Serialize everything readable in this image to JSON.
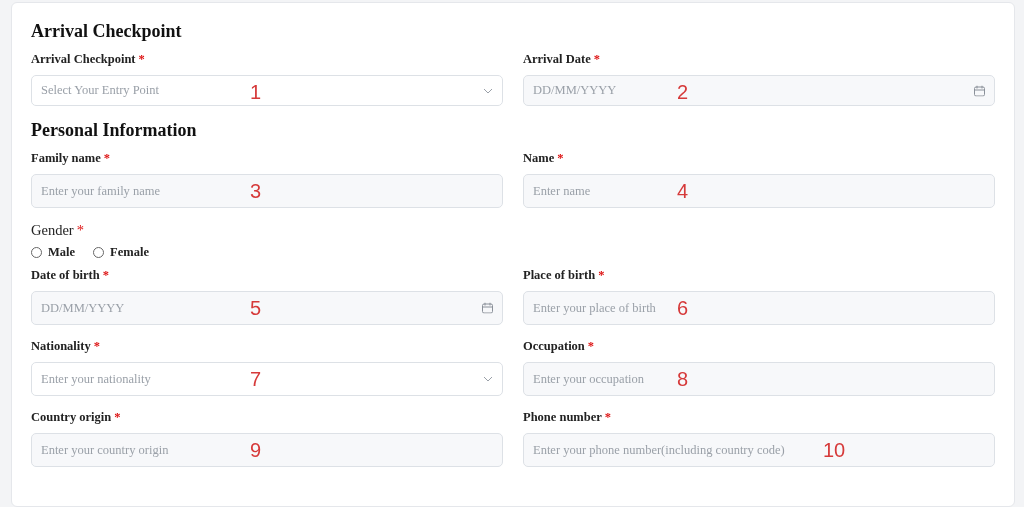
{
  "sections": [
    {
      "title": "Arrival Checkpoint",
      "rows": [
        [
          {
            "kind": "select",
            "label": "Arrival Checkpoint",
            "required": true,
            "placeholder": "Select Your Entry Point",
            "marker": "1"
          },
          {
            "kind": "date",
            "label": "Arrival Date",
            "required": true,
            "placeholder": "DD/MM/YYYY",
            "marker": "2"
          }
        ]
      ]
    },
    {
      "title": "Personal Information",
      "rows": [
        [
          {
            "kind": "text",
            "label": "Family name",
            "required": true,
            "placeholder": "Enter your family name",
            "marker": "3"
          },
          {
            "kind": "text",
            "label": "Name",
            "required": true,
            "placeholder": "Enter name",
            "marker": "4"
          }
        ],
        [
          {
            "kind": "radio",
            "label": "Gender",
            "required": true,
            "options": [
              {
                "label": "Male",
                "selected": false
              },
              {
                "label": "Female",
                "selected": false
              }
            ]
          }
        ],
        [
          {
            "kind": "date",
            "label": "Date of birth",
            "required": true,
            "placeholder": "DD/MM/YYYY",
            "marker": "5"
          },
          {
            "kind": "text",
            "label": "Place of birth",
            "required": true,
            "placeholder": "Enter your place of birth",
            "marker": "6"
          }
        ],
        [
          {
            "kind": "select",
            "label": "Nationality",
            "required": true,
            "placeholder": "Enter your nationality",
            "marker": "7"
          },
          {
            "kind": "text",
            "label": "Occupation",
            "required": true,
            "placeholder": "Enter your occupation",
            "marker": "8"
          }
        ],
        [
          {
            "kind": "text",
            "label": "Country origin",
            "required": true,
            "placeholder": "Enter your country origin",
            "marker": "9"
          },
          {
            "kind": "text",
            "label": "Phone number",
            "required": true,
            "placeholder": "Enter your phone number(including country code)",
            "marker": "10"
          }
        ]
      ]
    }
  ],
  "required_mark": "*"
}
